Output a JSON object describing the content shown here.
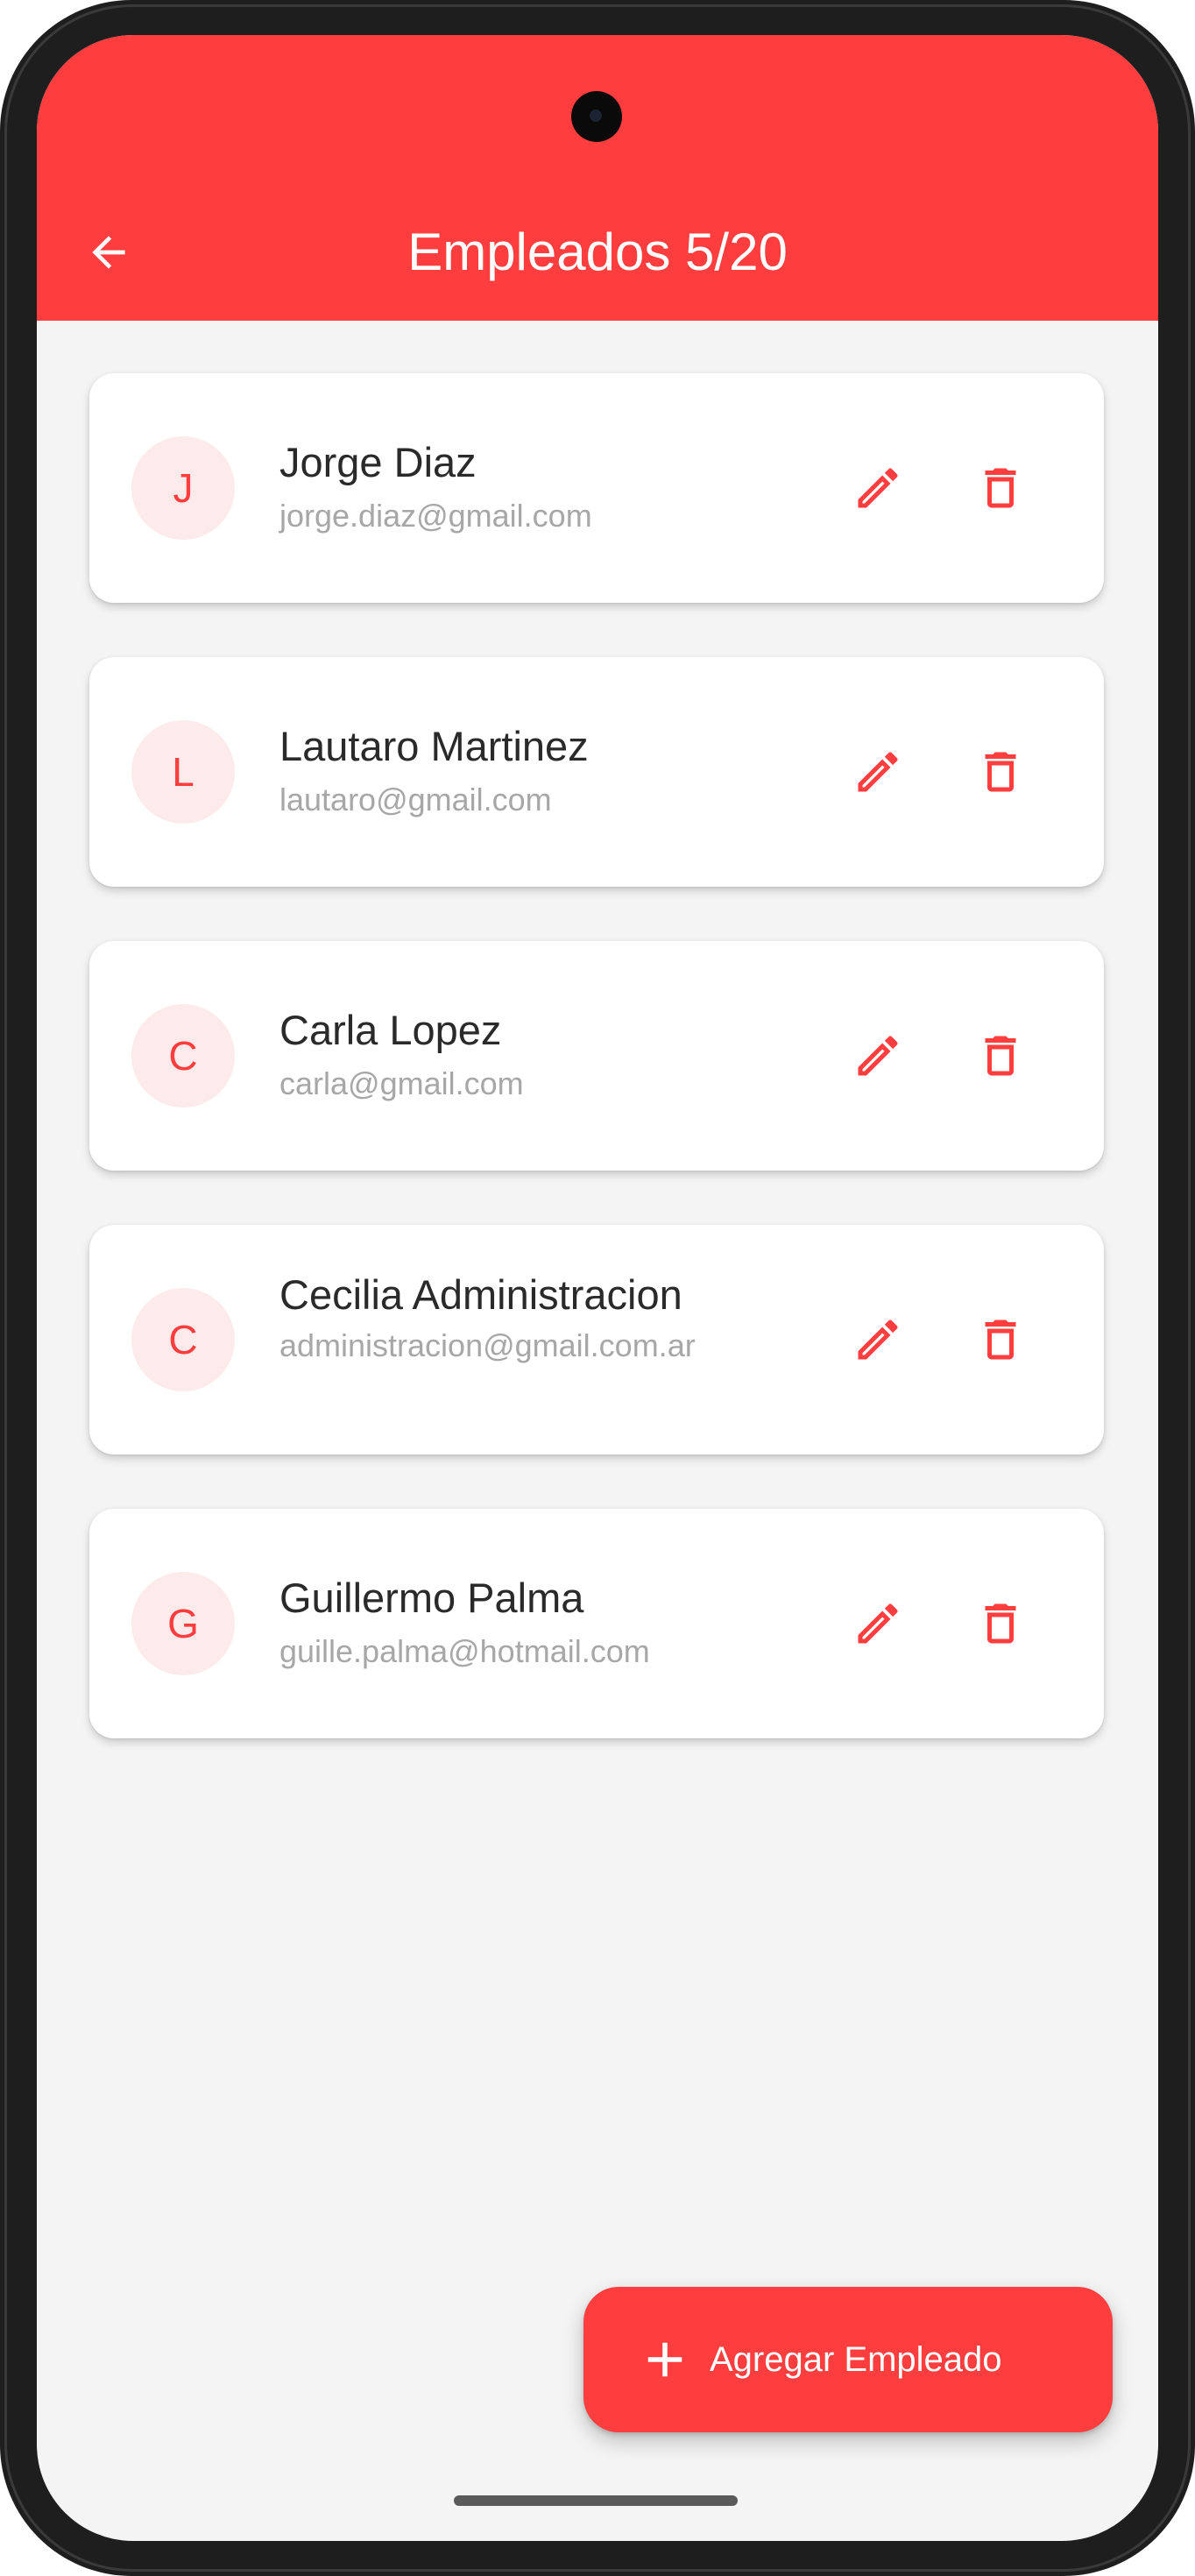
{
  "header": {
    "title": "Empleados 5/20"
  },
  "employees": [
    {
      "initial": "J",
      "name": "Jorge Diaz",
      "email": "jorge.diaz@gmail.com"
    },
    {
      "initial": "L",
      "name": "Lautaro Martinez",
      "email": "lautaro@gmail.com"
    },
    {
      "initial": "C",
      "name": "Carla Lopez",
      "email": "carla@gmail.com"
    },
    {
      "initial": "C",
      "name": "Cecilia Administracion",
      "email": "administracion@gmail.com.ar"
    },
    {
      "initial": "G",
      "name": "Guillermo Palma",
      "email": "guille.palma@hotmail.com"
    }
  ],
  "fab": {
    "label": "Agregar Empleado"
  },
  "colors": {
    "primary": "#fe3e3e",
    "background": "#f4f4f4",
    "card": "#ffffff",
    "avatar_bg": "#fdeaea",
    "name_text": "#2a2a2a",
    "email_text": "#a7a7a7"
  }
}
